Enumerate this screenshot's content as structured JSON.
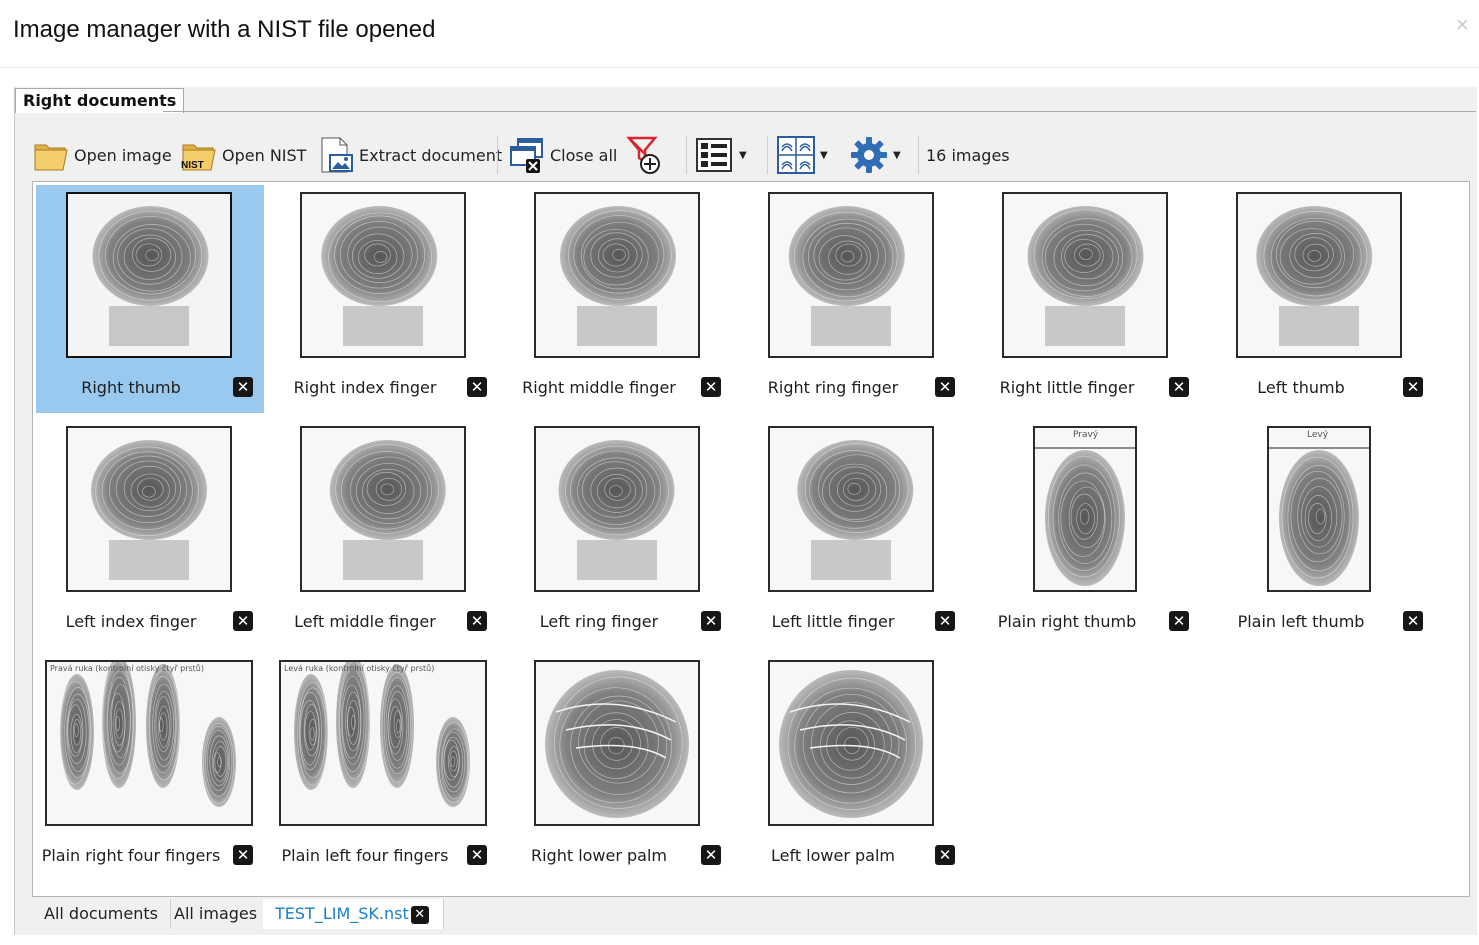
{
  "dialog": {
    "title": "Image manager with a NIST file opened",
    "close_glyph": "×"
  },
  "top_tab": {
    "label": "Right documents"
  },
  "toolbar": {
    "open_image": "Open image",
    "open_nist": "Open NIST",
    "nist_badge": "NIST",
    "extract_document": "Extract document",
    "close_all": "Close all",
    "image_count": "16 images",
    "icons": [
      "folder-icon",
      "nist-folder-icon",
      "extract-document-icon",
      "close-all-icon",
      "remove-filter-icon",
      "view-layout-icon",
      "fingerprint-view-icon",
      "settings-gear-icon"
    ]
  },
  "images": [
    {
      "label": "Right thumb",
      "selected": true,
      "shape": "roll"
    },
    {
      "label": "Right index finger",
      "shape": "roll"
    },
    {
      "label": "Right middle finger",
      "shape": "roll"
    },
    {
      "label": "Right ring finger",
      "shape": "roll"
    },
    {
      "label": "Right little finger",
      "shape": "roll"
    },
    {
      "label": "Left thumb",
      "shape": "roll"
    },
    {
      "label": "Left index finger",
      "shape": "roll"
    },
    {
      "label": "Left middle finger",
      "shape": "roll"
    },
    {
      "label": "Left ring finger",
      "shape": "roll"
    },
    {
      "label": "Left little finger",
      "shape": "roll"
    },
    {
      "label": "Plain right thumb",
      "shape": "plain",
      "caption": "Pravý"
    },
    {
      "label": "Plain left thumb",
      "shape": "plain",
      "caption": "Levý"
    },
    {
      "label": "Plain right four fingers",
      "shape": "four",
      "caption": "Pravá ruka (kontrolní otisky čtyř prstů)"
    },
    {
      "label": "Plain left four fingers",
      "shape": "four",
      "caption": "Levá ruka (kontrolní otisky čtyř prstů)"
    },
    {
      "label": "Right lower palm",
      "shape": "palm"
    },
    {
      "label": "Left lower palm",
      "shape": "palm"
    }
  ],
  "bottom_tabs": [
    {
      "label": "All documents"
    },
    {
      "label": "All images"
    },
    {
      "label": "TEST_LIM_SK.nst",
      "active": true
    }
  ],
  "colors": {
    "selection": "#99c9ef",
    "active_tab_text": "#1a7fc6",
    "close_button": "#161616"
  }
}
